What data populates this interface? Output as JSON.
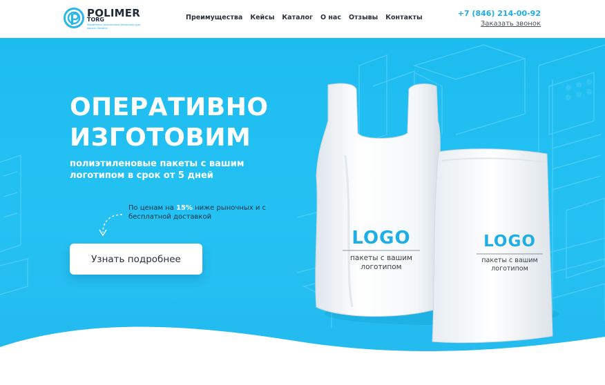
{
  "brand": {
    "name": "POLIMER",
    "sub": "TORG",
    "tagline": "Фирменные упаковочные материалы для вашего бизнеса"
  },
  "nav": {
    "items": [
      "Преимущества",
      "Кейсы",
      "Каталог",
      "О нас",
      "Отзывы",
      "Контакты"
    ]
  },
  "contact": {
    "phone": "+7 (846) 214-00-92",
    "callback": "Заказать звонок"
  },
  "hero": {
    "headline_line1": "ОПЕРАТИВНО",
    "headline_line2": "ИЗГОТОВИМ",
    "subhead": "полиэтиленовые пакеты с вашим логотипом в срок от 5 дней",
    "note_prefix": "По ценам на ",
    "note_highlight": "15%",
    "note_suffix": " ниже рыночных и с бесплатной доставкой",
    "cta_label": "Узнать подробнее"
  },
  "bags": {
    "left": {
      "logo": "LOGO",
      "caption_line1": "пакеты с вашим",
      "caption_line2": "логотипом"
    },
    "right": {
      "logo": "LOGO",
      "caption_line1": "пакеты с вашим",
      "caption_line2": "логотипом"
    }
  },
  "colors": {
    "accent": "#1eaee6",
    "hero_bg": "#25c1f3",
    "text_dark": "#2b2f38"
  }
}
